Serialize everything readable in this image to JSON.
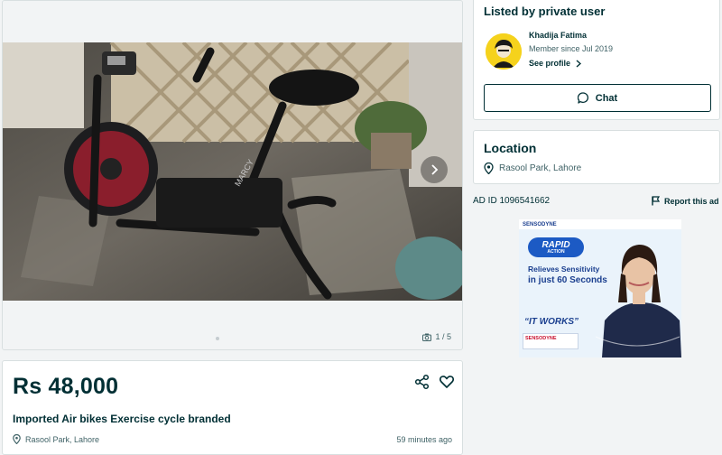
{
  "gallery": {
    "photo_alt": "Imported Air bikes Exercise cycle branded",
    "counter": "1 / 5"
  },
  "listing": {
    "price": "Rs 48,000",
    "title": "Imported Air bikes Exercise cycle branded",
    "location": "Rasool Park, Lahore",
    "time_ago": "59 minutes ago"
  },
  "seller": {
    "heading": "Listed by private user",
    "name": "Khadija Fatima",
    "member_since": "Member since Jul 2019",
    "see_profile": "See profile",
    "chat_label": "Chat"
  },
  "location_card": {
    "heading": "Location",
    "text": "Rasool Park, Lahore"
  },
  "ad": {
    "id_text": "AD ID 1096541662",
    "report_label": "Report this ad"
  },
  "banner": {
    "brand_top": "SENSODYNE",
    "rapid": "RAPID",
    "rapid_sub": "ACTION",
    "line1": "Relieves Sensitivity",
    "line2": "in just 60 Seconds",
    "it_works": "“IT WORKS”",
    "brand_box": "SENSODYNE"
  },
  "icons": {
    "next": "chevron-right-icon",
    "camera": "camera-icon",
    "share": "share-icon",
    "favorite": "heart-icon",
    "pin": "location-pin-icon",
    "chat": "chat-bubble-icon",
    "flag": "flag-icon"
  },
  "colors": {
    "text": "#002f34",
    "muted": "#406367",
    "border": "#d8dfe0",
    "avatar_bg": "#f5d21c"
  }
}
